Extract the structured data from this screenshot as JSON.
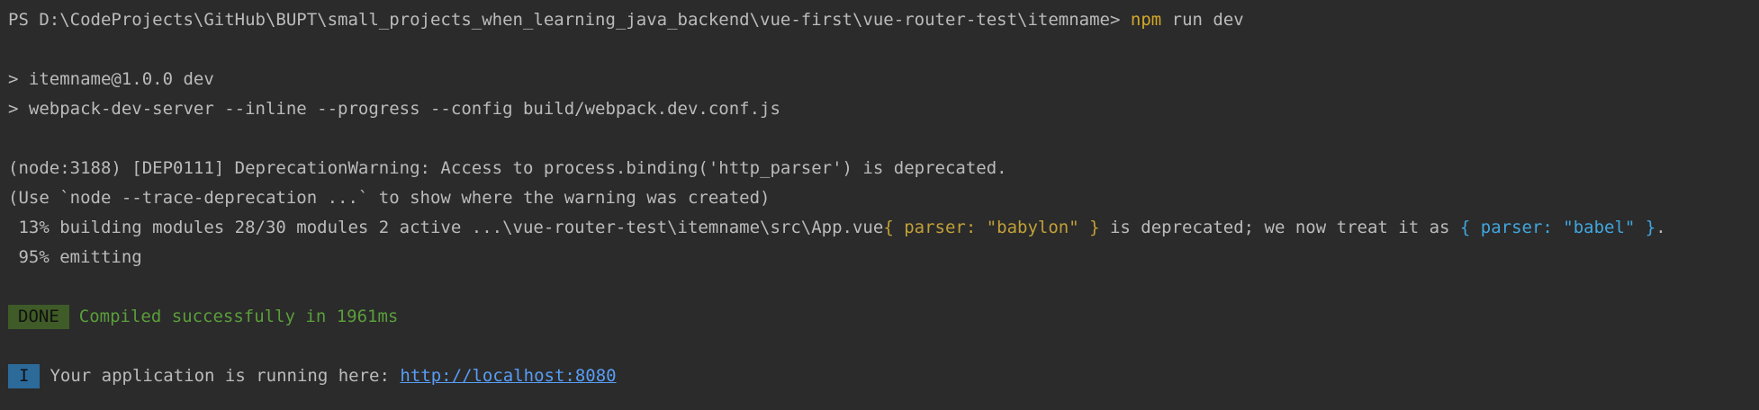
{
  "prompt": {
    "prefix": "PS D:\\CodeProjects\\GitHub\\BUPT\\small_projects_when_learning_java_backend\\vue-first\\vue-router-test\\itemname>",
    "command_npm": "npm",
    "command_args": " run dev"
  },
  "script_lines": [
    "> itemname@1.0.0 dev",
    "> webpack-dev-server --inline --progress --config build/webpack.dev.conf.js"
  ],
  "warnings": [
    "(node:3188) [DEP0111] DeprecationWarning: Access to process.binding('http_parser') is deprecated.",
    "(Use `node --trace-deprecation ...` to show where the warning was created)"
  ],
  "progress": {
    "building_prefix": " 13% building modules 28/30 modules 2 active ...\\vue-router-test\\itemname\\src\\App.vue",
    "parser_old": "{ parser: \"babylon\" }",
    "middle_text": " is deprecated; we now treat it as ",
    "parser_new": "{ parser: \"babel\" }",
    "end_text": ".",
    "emitting": " 95% emitting"
  },
  "done": {
    "badge": "DONE",
    "message": "Compiled successfully in 1961ms"
  },
  "info": {
    "badge": "I",
    "message": "Your application is running here: ",
    "url": "http://localhost:8080"
  },
  "colors": {
    "background": "#2b2b2b",
    "text": "#bbbbbb",
    "npm_command": "#d3a82b",
    "parser_old": "#c2a037",
    "parser_new": "#40a6df",
    "success": "#5a9e3a",
    "done_badge_bg": "#3f5b27",
    "info_badge_bg": "#2c6a9a",
    "link": "#589df6"
  }
}
